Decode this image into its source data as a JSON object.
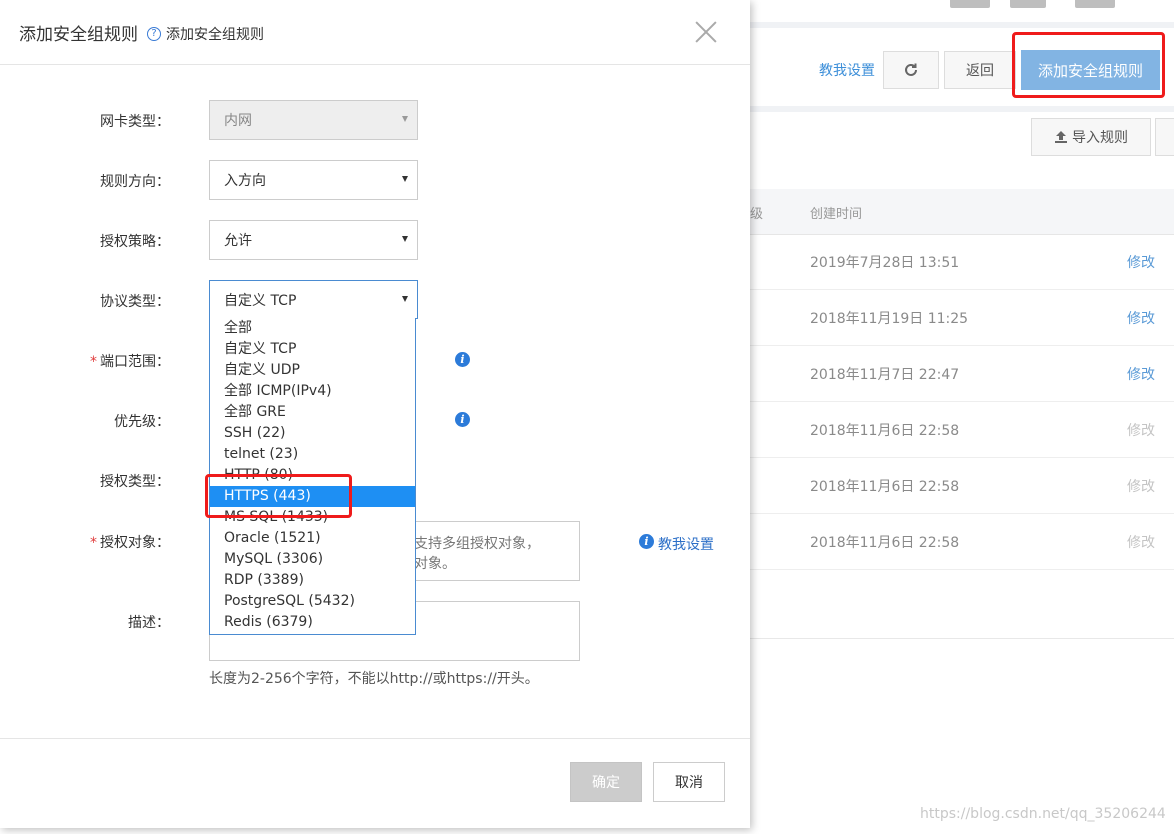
{
  "background": {
    "toolbar": {
      "teach_link": "教我设置",
      "back_label": "返回",
      "add_rule_label": "添加安全组规则",
      "import_label": "导入规则"
    },
    "table": {
      "col_priority_partial": "级",
      "col_created": "创建时间",
      "rows": [
        {
          "created": "2019年7月28日 13:51",
          "action": "修改",
          "enabled": true
        },
        {
          "created": "2018年11月19日 11:25",
          "action": "修改",
          "enabled": true
        },
        {
          "created": "2018年11月7日 22:47",
          "action": "修改",
          "enabled": true
        },
        {
          "created": "2018年11月6日 22:58",
          "action": "修改",
          "enabled": false
        },
        {
          "created": "2018年11月6日 22:58",
          "action": "修改",
          "enabled": false
        },
        {
          "created": "2018年11月6日 22:58",
          "action": "修改",
          "enabled": false
        }
      ]
    },
    "watermark": "https://blog.csdn.net/qq_35206244"
  },
  "modal": {
    "title": "添加安全组规则",
    "help_text": "添加安全组规则",
    "labels": {
      "nic_type": "网卡类型：",
      "direction": "规则方向：",
      "policy": "授权策略：",
      "protocol": "协议类型：",
      "port_range": "端口范围：",
      "priority": "优先级：",
      "auth_type": "授权类型：",
      "auth_object": "授权对象：",
      "description": "描述："
    },
    "values": {
      "nic_type": "内网",
      "direction": "入方向",
      "policy": "允许",
      "protocol": "自定义 TCP"
    },
    "auth_object_hint_line1": "支持多组授权对象，",
    "auth_object_hint_line2": "对象。",
    "teach_link": "教我设置",
    "description_hint": "长度为2-256个字符，不能以http://或https://开头。",
    "ok_label": "确定",
    "cancel_label": "取消"
  },
  "protocol_options": [
    "全部",
    "自定义 TCP",
    "自定义 UDP",
    "全部 ICMP(IPv4)",
    "全部 GRE",
    "SSH (22)",
    "telnet (23)",
    "HTTP (80)",
    "HTTPS (443)",
    "MS SQL (1433)",
    "Oracle (1521)",
    "MySQL (3306)",
    "RDP (3389)",
    "PostgreSQL (5432)",
    "Redis (6379)"
  ],
  "highlighted_option_index": 8,
  "icons": {
    "refresh": "refresh-icon",
    "upload": "upload-icon",
    "close": "close-icon",
    "help": "help-icon",
    "info": "info-icon"
  },
  "colors": {
    "primary": "#82b4e3",
    "highlight": "#1e8ff3",
    "annotation_red": "#ef1b1b",
    "link": "#2c6fc7"
  }
}
